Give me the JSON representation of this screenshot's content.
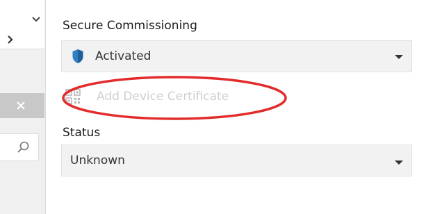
{
  "sections": {
    "secure_commissioning_label": "Secure Commissioning",
    "secure_commissioning_value": "Activated",
    "add_certificate_label": "Add Device Certificate",
    "status_label": "Status",
    "status_value": "Unknown"
  },
  "icons": {
    "left_dropdown": "chevron-down-icon",
    "left_expand": "chevron-right-icon",
    "close": "close-icon",
    "search": "search-icon",
    "shield": "shield-icon",
    "certificate": "qr-code-icon",
    "dropdown_arrow": "dropdown-arrow-icon"
  },
  "colors": {
    "shield_blue": "#2f7fc4",
    "annotation_red": "#e32b2b",
    "disabled_text": "#cfcfcf"
  }
}
